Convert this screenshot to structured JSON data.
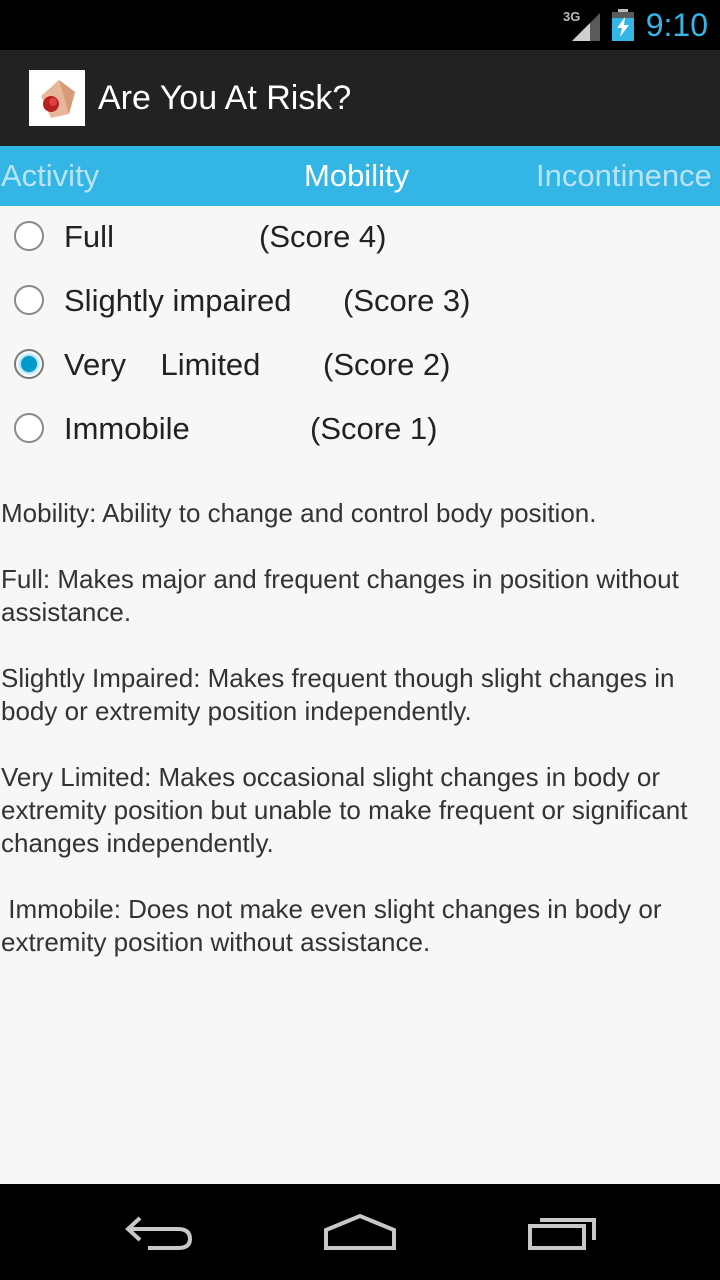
{
  "status_bar": {
    "network": "3G",
    "time": "9:10"
  },
  "action_bar": {
    "title": "Are You At Risk?"
  },
  "tabs": {
    "left": "Activity",
    "selected": "Mobility",
    "right": "Incontinence"
  },
  "options": [
    {
      "label": "Full",
      "score": "(Score 4)",
      "checked": false
    },
    {
      "label": "Slightly impaired",
      "score": "(Score 3)",
      "checked": false
    },
    {
      "label": "Very    Limited",
      "score": "(Score 2)",
      "checked": true
    },
    {
      "label": "Immobile",
      "score": "(Score 1)",
      "checked": false
    }
  ],
  "description": {
    "intro": "Mobility: Ability to change and control body position.",
    "full": "Full: Makes major and frequent changes in position without assistance.",
    "slightly_impaired": "Slightly Impaired: Makes frequent though slight changes in body or extremity position independently.",
    "very_limited": "Very Limited: Makes occasional slight changes in body or extremity position but unable to make frequent or significant changes independently.",
    "immobile": " Immobile: Does not make even slight changes in body or extremity position without assistance."
  },
  "colors": {
    "accent": "#33b5e5",
    "radio_checked": "#0099cc",
    "action_bar": "#222222"
  }
}
